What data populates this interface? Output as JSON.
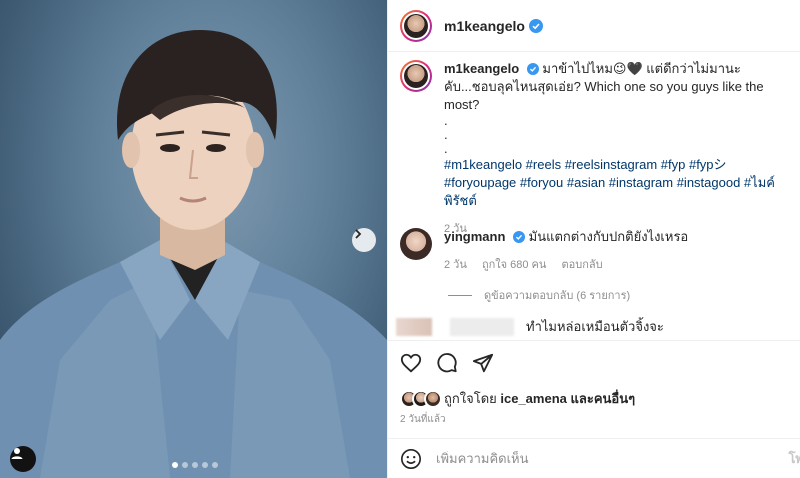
{
  "post": {
    "username": "m1keangelo",
    "caption_text": "มาข้าไปไหม😉🖤 แต่ดีกว่าไม่มานะคับ...ชอบลุคไหนสุดเอ่ย? Which one so you guys like the most?",
    "caption_dots": [
      ".",
      ".",
      "."
    ],
    "hashtags": "#m1keangelo #reels #reelsinstagram #fyp #fypシ #foryoupage #foryou #asian #instagram #instagood #ไมค์พิรัชต์",
    "caption_age": "2 วัน"
  },
  "comment": {
    "username": "yingmann",
    "text": "มันแตกต่างกับปกติยังไงเหรอ",
    "age": "2 วัน",
    "likes": "ถูกใจ 680 คน",
    "reply_label": "ตอบกลับ",
    "view_replies": "ดูข้อความตอบกลับ (6 รายการ)"
  },
  "blurred_comment": {
    "text": "ทำไมหล่อเหมือนตัวจิ้งจะ"
  },
  "likes_summary": {
    "prefix": "ถูกใจโดย",
    "user": "ice_amena",
    "suffix": "และคนอื่นๆ"
  },
  "post_time": "2 วันที่แล้ว",
  "add_comment": {
    "placeholder": "เพิ่มความคิดเห็น",
    "post_label": "โพ"
  },
  "carousel": {
    "total": 5,
    "active_index": 0
  },
  "colors": {
    "verified": "#3897f0",
    "hashtag": "#00376b",
    "muted": "#8e8e8e"
  }
}
